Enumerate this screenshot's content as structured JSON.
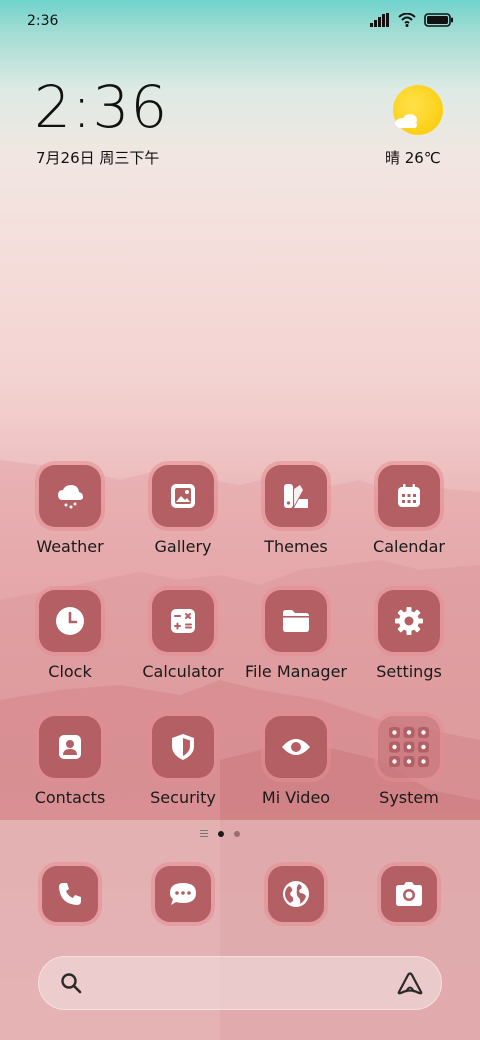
{
  "status_bar": {
    "time": "2:36"
  },
  "clock_widget": {
    "time": "2:36",
    "date": "7月26日 周三下午"
  },
  "weather_widget": {
    "text": "晴 26℃",
    "icon": "sunny-cloud-icon"
  },
  "apps": [
    {
      "label": "Weather",
      "icon": "weather-icon"
    },
    {
      "label": "Gallery",
      "icon": "gallery-icon"
    },
    {
      "label": "Themes",
      "icon": "themes-icon"
    },
    {
      "label": "Calendar",
      "icon": "calendar-icon"
    },
    {
      "label": "Clock",
      "icon": "clock-icon"
    },
    {
      "label": "Calculator",
      "icon": "calculator-icon"
    },
    {
      "label": "File Manager",
      "icon": "folder-icon"
    },
    {
      "label": "Settings",
      "icon": "gear-icon"
    },
    {
      "label": "Contacts",
      "icon": "contacts-icon"
    },
    {
      "label": "Security",
      "icon": "shield-icon"
    },
    {
      "label": "Mi Video",
      "icon": "eye-icon"
    },
    {
      "label": "System",
      "icon": "folder-grid-icon"
    }
  ],
  "dock": [
    {
      "icon": "phone-icon"
    },
    {
      "icon": "message-icon"
    },
    {
      "icon": "globe-icon"
    },
    {
      "icon": "camera-icon"
    }
  ],
  "page_indicator": {
    "pages": 2,
    "active": 1
  },
  "colors": {
    "tile": "#b45f63",
    "tile_ring": "#e68c91"
  }
}
